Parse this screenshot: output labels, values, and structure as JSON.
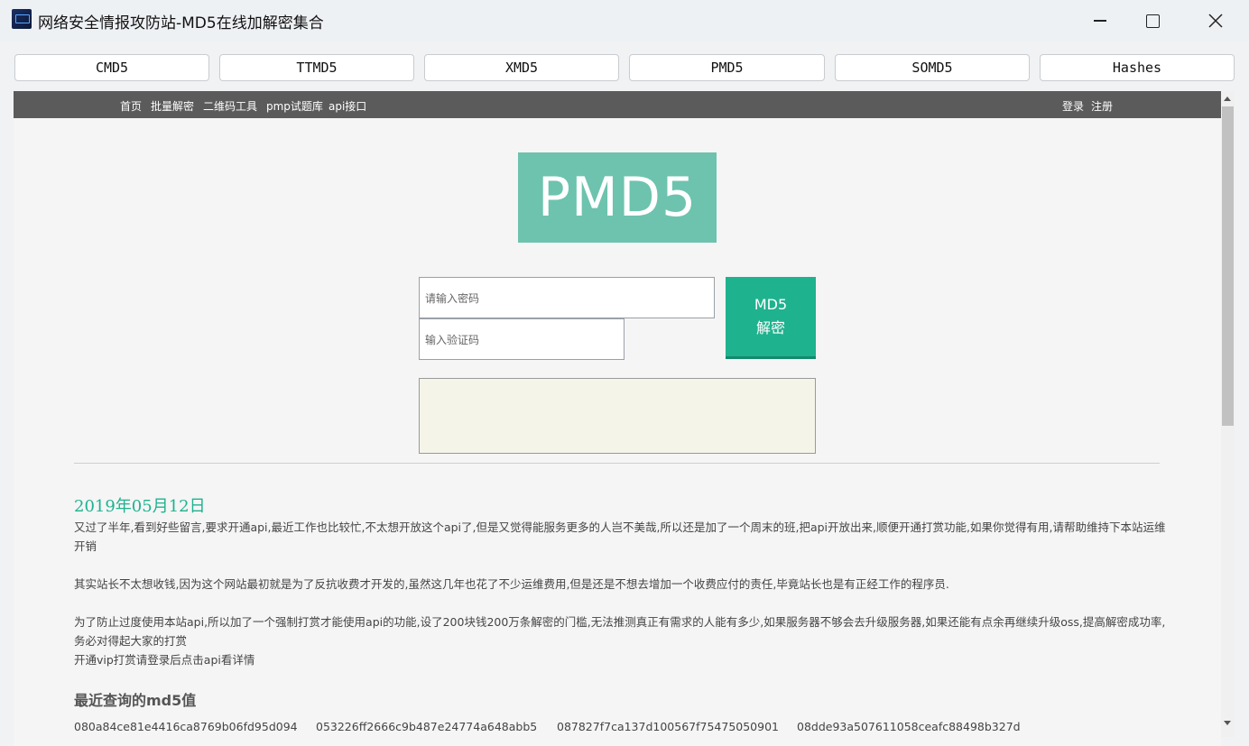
{
  "window": {
    "title": "网络安全情报攻防站-MD5在线加解密集合",
    "icon": "app-logo-icon"
  },
  "tabs": [
    {
      "label": "CMD5"
    },
    {
      "label": "TTMD5"
    },
    {
      "label": "XMD5"
    },
    {
      "label": "PMD5"
    },
    {
      "label": "SOMD5"
    },
    {
      "label": "Hashes"
    }
  ],
  "nav": {
    "links": [
      "首页",
      "批量解密",
      "二维码工具",
      "pmp试题库",
      "api接口"
    ],
    "login": "登录",
    "register": "注册"
  },
  "logo": {
    "text": "PMD5",
    "color": "#6dc3ae"
  },
  "form": {
    "password_placeholder": "请输入密码",
    "captcha_placeholder": "输入验证码",
    "button_line1": "MD5",
    "button_line2": "解密",
    "button_color": "#1fb28f"
  },
  "article": {
    "date": "2019年05月12日",
    "p1": "又过了半年,看到好些留言,要求开通api,最近工作也比较忙,不太想开放这个api了,但是又觉得能服务更多的人岂不美哉,所以还是加了一个周末的班,把api开放出来,顺便开通打赏功能,如果你觉得有用,请帮助维持下本站运维开销",
    "p2": "其实站长不太想收钱,因为这个网站最初就是为了反抗收费才开发的,虽然这几年也花了不少运维费用,但是还是不想去增加一个收费应付的责任,毕竟站长也是有正经工作的程序员.",
    "p3": "为了防止过度使用本站api,所以加了一个强制打赏才能使用api的功能,设了200块钱200万条解密的门槛,无法推测真正有需求的人能有多少,如果服务器不够会去升级服务器,如果还能有点余再继续升级oss,提高解密成功率,务必对得起大家的打赏",
    "p4": "开通vip打赏请登录后点击api看详情"
  },
  "recent": {
    "title": "最近查询的md5值",
    "hashes": [
      "080a84ce81e4416ca8769b06fd95d094",
      "053226ff2666c9b487e24774a648abb5",
      "087827f7ca137d100567f75475050901",
      "08dde93a507611058ceafc88498b327d"
    ]
  }
}
